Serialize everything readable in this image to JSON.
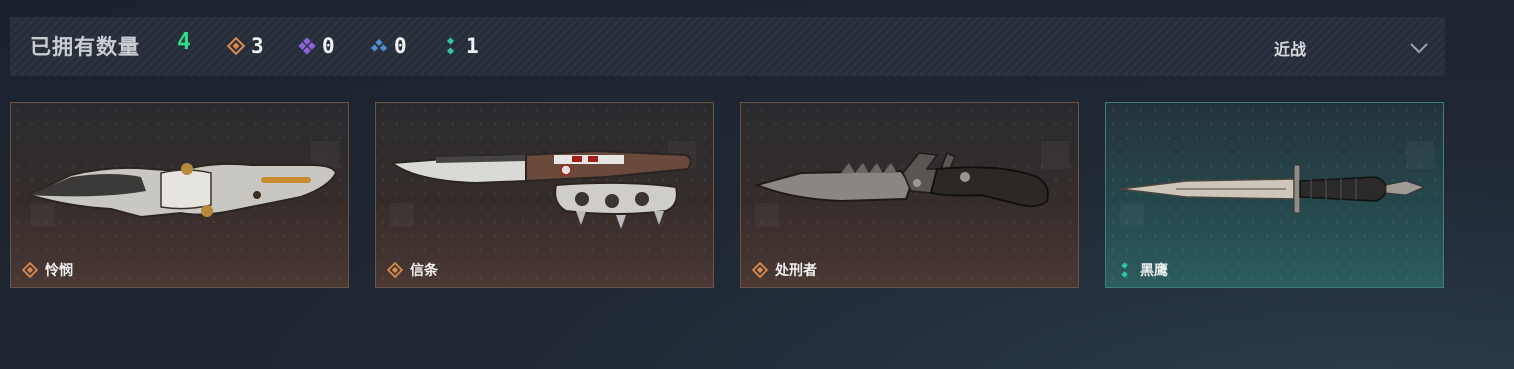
{
  "header": {
    "owned_label": "已拥有数量",
    "owned_count": "4",
    "rarity_counts": [
      {
        "icon": "orange-diamond-icon",
        "color": "#d98a4e",
        "count": "3"
      },
      {
        "icon": "purple-diamond-icon",
        "color": "#8c63d8",
        "count": "0"
      },
      {
        "icon": "blue-diamond-icon",
        "color": "#4f8fd6",
        "count": "0"
      },
      {
        "icon": "green-dots-icon",
        "color": "#2fc99b",
        "count": "1"
      }
    ],
    "filter": {
      "selected": "近战"
    }
  },
  "cards": [
    {
      "name": "怜悯",
      "rarity": "orange",
      "knife": "karambit-style folding knife"
    },
    {
      "name": "信条",
      "rarity": "orange",
      "knife": "knuckle-guard combat knife"
    },
    {
      "name": "处刑者",
      "rarity": "orange",
      "knife": "serrated tactical knife"
    },
    {
      "name": "黑鹰",
      "rarity": "green",
      "knife": "dagger"
    }
  ],
  "colors": {
    "orange_rarity": "#d98a4e",
    "purple_rarity": "#8c63d8",
    "blue_rarity": "#4f8fd6",
    "green_rarity": "#2fc99b",
    "owned_count": "#35d98a"
  }
}
